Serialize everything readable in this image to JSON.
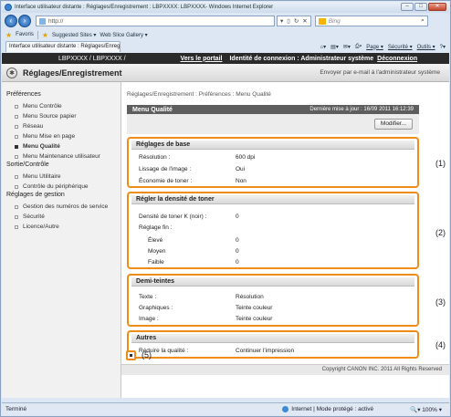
{
  "window": {
    "title": "Interface utilisateur distante : Réglages/Enregistrement : LBPXXXX: LBPXXXX- Windows Internet Explorer",
    "min": "–",
    "max": "□",
    "close": "✕"
  },
  "address": {
    "url": "http://",
    "search_placeholder": "Bing"
  },
  "favorites": {
    "favoris": "Favoris",
    "suggested": "Suggested Sites ▾",
    "webslice": "Web Slice Gallery ▾"
  },
  "tab": {
    "label": "Interface utilisateur distante : Réglages/Enregistre..."
  },
  "commands": {
    "page": "Page ▾",
    "securite": "Sécurité ▾",
    "outils": "Outils ▾"
  },
  "topbar": {
    "model": "LBPXXXX / LBPXXXX /",
    "portal": "Vers le portail",
    "identity": "Identité de connexion : Administrateur système",
    "logout": "Déconnexion"
  },
  "header": {
    "title": "Réglages/Enregistrement",
    "mail": "Envoyer par e-mail à l'administrateur système"
  },
  "sidebar": {
    "groups": [
      {
        "label": "Préférences",
        "items": [
          "Menu Contrôle",
          "Menu Source papier",
          "Réseau",
          "Menu Mise en page",
          "Menu Qualité",
          "Menu Maintenance utilisateur"
        ]
      },
      {
        "label": "Sortie/Contrôle",
        "items": [
          "Menu Utilitaire",
          "Contrôle du périphérique"
        ]
      },
      {
        "label": "Réglages de gestion",
        "items": [
          "Gestion des numéros de service",
          "Sécurité",
          "Licence/Autre"
        ]
      }
    ],
    "active": "Menu Qualité"
  },
  "main": {
    "breadcrumb": "Réglages/Enregistrement : Préférences : Menu Qualité",
    "menu_title": "Menu Qualité",
    "last_update": "Dernière mise à jour : 16/09 2011 16:12:39",
    "modify": "Modifier..."
  },
  "sections": {
    "base": {
      "title": "Réglages de base",
      "rows": [
        {
          "label": "Résolution :",
          "value": "600 dpi"
        },
        {
          "label": "Lissage de l'image :",
          "value": "Oui"
        },
        {
          "label": "Économie de toner :",
          "value": "Non"
        }
      ],
      "marker": "(1)"
    },
    "density": {
      "title": "Régler la densité de toner",
      "k_label": "Densité de toner K (noir) :",
      "k_value": "0",
      "fine_label": "Réglage fin :",
      "rows": [
        {
          "label": "Élevé",
          "value": "0"
        },
        {
          "label": "Moyen",
          "value": "0"
        },
        {
          "label": "Faible",
          "value": "0"
        }
      ],
      "marker": "(2)"
    },
    "halftone": {
      "title": "Demi-teintes",
      "rows": [
        {
          "label": "Texte :",
          "value": "Résolution"
        },
        {
          "label": "Graphiques :",
          "value": "Teinte couleur"
        },
        {
          "label": "Image :",
          "value": "Teinte couleur"
        }
      ],
      "marker": "(3)"
    },
    "other": {
      "title": "Autres",
      "rows": [
        {
          "label": "Réduire la qualité :",
          "value": "Continuer l'impression"
        }
      ],
      "marker": "(4)"
    }
  },
  "bottom_marker": "(5)",
  "footer": "Copyright CANON INC. 2011 All Rights Reserved",
  "status": {
    "left": "Terminé",
    "zone": "Internet | Mode protégé : activé",
    "zoom": "100%"
  }
}
